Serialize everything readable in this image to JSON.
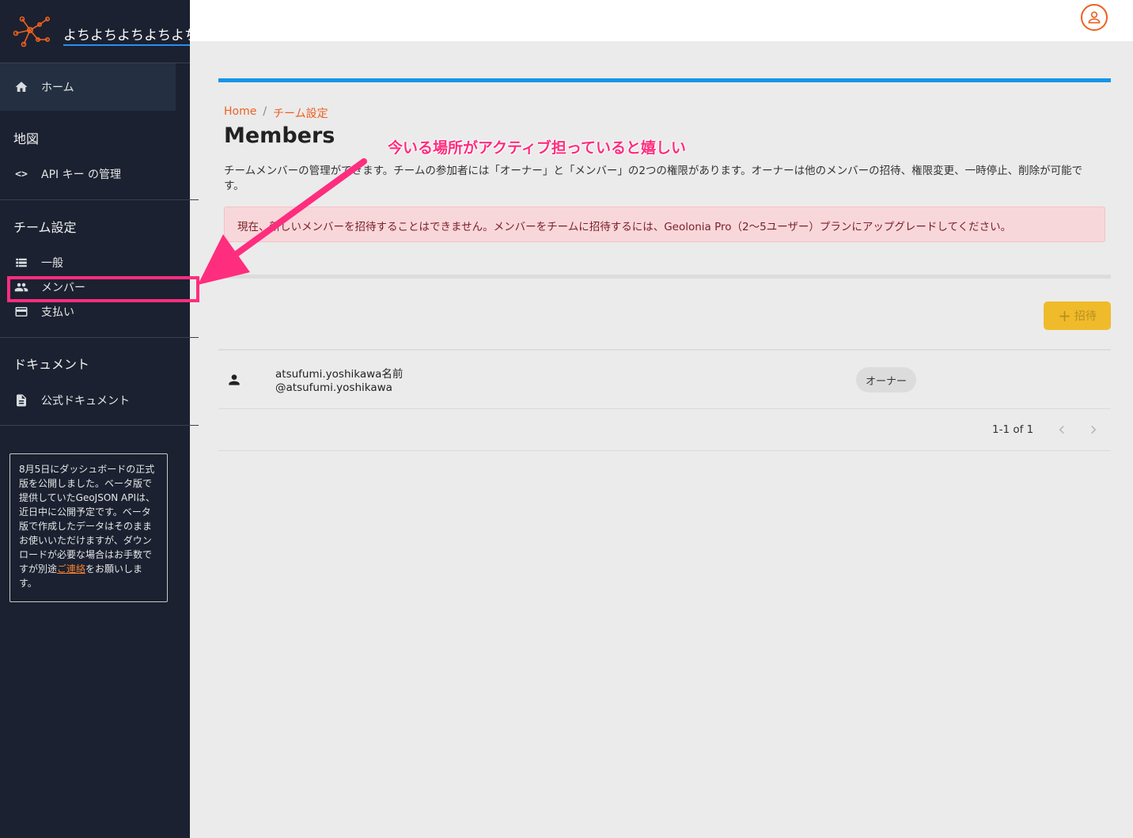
{
  "sidebar": {
    "brand_name": "よちよちよちよちよちよち",
    "home_label": "ホーム",
    "section_map": "地図",
    "api_keys_label": "API キー の管理",
    "section_team": "チーム設定",
    "general_label": "一般",
    "members_label": "メンバー",
    "billing_label": "支払い",
    "section_docs": "ドキュメント",
    "docs_label": "公式ドキュメント",
    "notice_text": "8月5日にダッシュボードの正式版を公開しました。ベータ版で提供していたGeoJSON APIは、近日中に公開予定です。ベータ版で作成したデータはそのままお使いいただけますが、ダウンロードが必要な場合はお手数ですが別途",
    "notice_link": "ご連絡",
    "notice_suffix": "をお願いします。"
  },
  "breadcrumb": {
    "home": "Home",
    "separator": "/",
    "current": "チーム設定"
  },
  "page": {
    "title": "Members",
    "description": "チームメンバーの管理ができます。チームの参加者には「オーナー」と「メンバー」の2つの権限があります。オーナーは他のメンバーの招待、権限変更、一時停止、削除が可能です。",
    "alert": "現在、新しいメンバーを招待することはできません。メンバーをチームに招待するには、Geolonia Pro（2〜5ユーザー）プランにアップグレードしてください。",
    "invite_label": "招待"
  },
  "members": [
    {
      "name": "atsufumi.yoshikawa名前",
      "handle": "@atsufumi.yoshikawa",
      "role": "オーナー"
    }
  ],
  "pagination": {
    "info": "1-1 of 1"
  },
  "annotation": {
    "text": "今いる場所がアクティブ担っていると嬉しい"
  },
  "colors": {
    "sidebar_bg": "#1b2130",
    "accent_orange": "#ee6020",
    "accent_blue": "#1694e8",
    "invite_yellow": "#f0bb2b",
    "annotation_pink": "#ff2d7e"
  }
}
